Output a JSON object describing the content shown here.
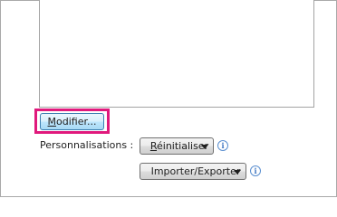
{
  "customize_ribbon": {
    "modify_button": {
      "mnemonic": "M",
      "label_rest": "odifier..."
    },
    "personalisations_label": "Personnalisations :",
    "reset_button": {
      "mnemonic": "R",
      "label_rest": "éinitialiser",
      "icon": "chevron-down-icon"
    },
    "reset_info": {
      "glyph": "i",
      "icon": "info-icon"
    },
    "import_export_button": {
      "mnemonic": "",
      "label_rest": "Importer/Exporter",
      "icon": "chevron-down-icon"
    },
    "import_export_info": {
      "glyph": "i",
      "icon": "info-icon"
    },
    "highlight_color": "#e0197c",
    "info_color": "#3b73c0"
  }
}
